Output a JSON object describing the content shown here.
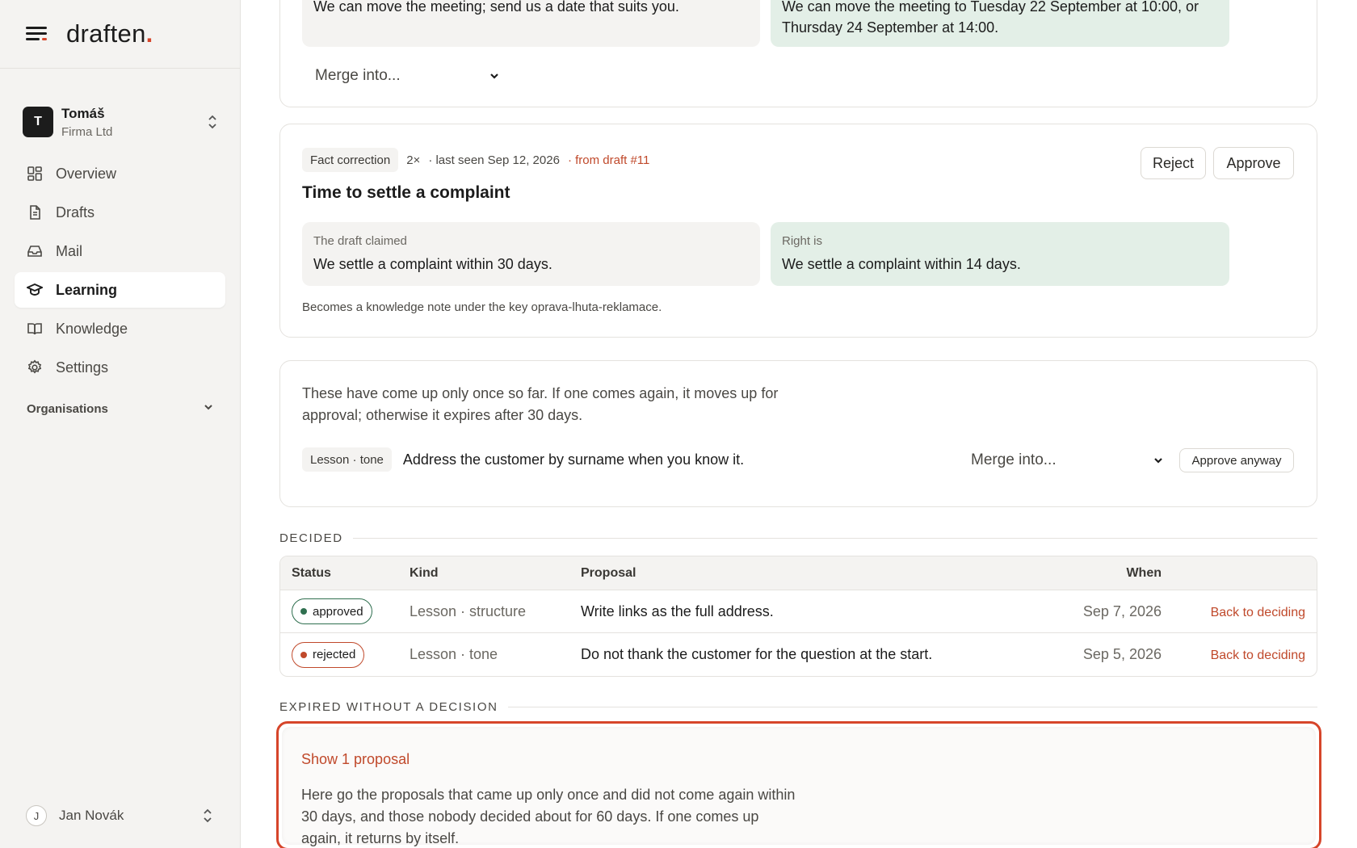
{
  "brand": {
    "name": "draften",
    "dot": "."
  },
  "account": {
    "initial": "T",
    "name": "Tomáš",
    "org": "Firma Ltd"
  },
  "nav": [
    {
      "label": "Overview",
      "icon": "grid-icon"
    },
    {
      "label": "Drafts",
      "icon": "document-icon"
    },
    {
      "label": "Mail",
      "icon": "inbox-icon"
    },
    {
      "label": "Learning",
      "icon": "graduation-cap-icon",
      "active": true
    },
    {
      "label": "Knowledge",
      "icon": "book-icon"
    },
    {
      "label": "Settings",
      "icon": "gear-icon"
    }
  ],
  "organisations_label": "Organisations",
  "user": {
    "initial": "J",
    "name": "Jan Novák"
  },
  "top_card": {
    "left_text": "We can move the meeting; send us a date that suits you.",
    "right_text": "We can move the meeting to Tuesday 22 September at 10:00, or Thursday 24 September at 14:00.",
    "merge_placeholder": "Merge into..."
  },
  "fact_card": {
    "kind": "Fact correction",
    "count": "2×",
    "last_seen": "· last seen Sep 12, 2026",
    "source": "· from draft #11",
    "title": "Time to settle a complaint",
    "reject_label": "Reject",
    "approve_label": "Approve",
    "claimed_label": "The draft claimed",
    "claimed_text": "We settle a complaint within 30 days.",
    "right_label": "Right is",
    "right_text": "We settle a complaint within 14 days.",
    "note": "Becomes a knowledge note under the key oprava-lhuta-reklamace."
  },
  "once_card": {
    "intro": "These have come up only once so far. If one comes again, it moves up for approval; otherwise it expires after 30 days.",
    "chip": "Lesson · tone",
    "text": "Address the customer by surname when you know it.",
    "merge_placeholder": "Merge into...",
    "approve_anyway_label": "Approve anyway"
  },
  "decided": {
    "label": "DECIDED",
    "headers": {
      "status": "Status",
      "kind": "Kind",
      "proposal": "Proposal",
      "when": "When"
    },
    "rows": [
      {
        "status": "approved",
        "kind": "Lesson · structure",
        "proposal": "Write links as the full address.",
        "when": "Sep 7, 2026",
        "action": "Back to deciding"
      },
      {
        "status": "rejected",
        "kind": "Lesson · tone",
        "proposal": "Do not thank the customer for the question at the start.",
        "when": "Sep 5, 2026",
        "action": "Back to deciding"
      }
    ]
  },
  "expired": {
    "label": "EXPIRED WITHOUT A DECISION",
    "show_label": "Show 1 proposal",
    "text": "Here go the proposals that came up only once and did not come again within 30 days, and those nobody decided about for 60 days. If one comes up again, it returns by itself."
  },
  "colors": {
    "accent": "#d6452a",
    "approved": "#2f6f4f",
    "rejected": "#c0492b",
    "green_box": "#e3efe7"
  }
}
